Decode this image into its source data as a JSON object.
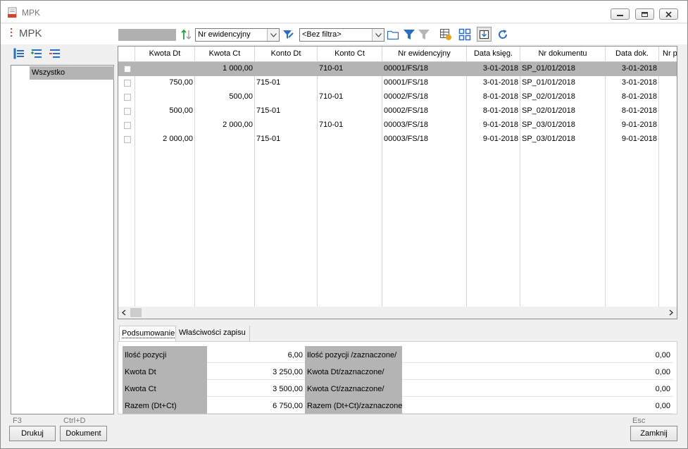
{
  "window": {
    "title": "MPK"
  },
  "header": {
    "title": "MPK"
  },
  "toolbar": {
    "sort_field": "Nr ewidencyjny",
    "filter": "<Bez filtra>"
  },
  "tree": {
    "items": [
      "Wszystko"
    ]
  },
  "grid": {
    "columns": [
      "Kwota Dt",
      "Kwota Ct",
      "Konto Dt",
      "Konto Ct",
      "Nr ewidencyjny",
      "Data księg.",
      "Nr dokumentu",
      "Data dok.",
      "Nr p"
    ],
    "rows": [
      {
        "kwota_dt": "",
        "kwota_ct": "1 000,00",
        "konto_dt": "",
        "konto_ct": "710-01",
        "nr_ewid": "00001/FS/18",
        "data_ksieg": "3-01-2018",
        "nr_dok": "SP_01/01/2018",
        "data_dok": "3-01-2018"
      },
      {
        "kwota_dt": "750,00",
        "kwota_ct": "",
        "konto_dt": "715-01",
        "konto_ct": "",
        "nr_ewid": "00001/FS/18",
        "data_ksieg": "3-01-2018",
        "nr_dok": "SP_01/01/2018",
        "data_dok": "3-01-2018"
      },
      {
        "kwota_dt": "",
        "kwota_ct": "500,00",
        "konto_dt": "",
        "konto_ct": "710-01",
        "nr_ewid": "00002/FS/18",
        "data_ksieg": "8-01-2018",
        "nr_dok": "SP_02/01/2018",
        "data_dok": "8-01-2018"
      },
      {
        "kwota_dt": "500,00",
        "kwota_ct": "",
        "konto_dt": "715-01",
        "konto_ct": "",
        "nr_ewid": "00002/FS/18",
        "data_ksieg": "8-01-2018",
        "nr_dok": "SP_02/01/2018",
        "data_dok": "8-01-2018"
      },
      {
        "kwota_dt": "",
        "kwota_ct": "2 000,00",
        "konto_dt": "",
        "konto_ct": "710-01",
        "nr_ewid": "00003/FS/18",
        "data_ksieg": "9-01-2018",
        "nr_dok": "SP_03/01/2018",
        "data_dok": "9-01-2018"
      },
      {
        "kwota_dt": "2 000,00",
        "kwota_ct": "",
        "konto_dt": "715-01",
        "konto_ct": "",
        "nr_ewid": "00003/FS/18",
        "data_ksieg": "9-01-2018",
        "nr_dok": "SP_03/01/2018",
        "data_dok": "9-01-2018"
      }
    ]
  },
  "tabs": [
    "Podsumowanie",
    "Właściwości zapisu"
  ],
  "summary": {
    "rows": [
      {
        "label": "Ilość pozycji",
        "value": "6,00",
        "label2": "Ilość pozycji /zaznaczone/",
        "value2": "0,00"
      },
      {
        "label": "Kwota Dt",
        "value": "3 250,00",
        "label2": "Kwota Dt/zaznaczone/",
        "value2": "0,00"
      },
      {
        "label": "Kwota Ct",
        "value": "3 500,00",
        "label2": "Kwota Ct/zaznaczone/",
        "value2": "0,00"
      },
      {
        "label": "Razem (Dt+Ct)",
        "value": "6 750,00",
        "label2": "Razem (Dt+Ct)/zaznaczone/",
        "value2": "0,00"
      }
    ]
  },
  "footer": {
    "print_key": "F3",
    "document_key": "Ctrl+D",
    "close_key": "Esc",
    "print_label": "Drukuj",
    "document_label": "Dokument",
    "close_label": "Zamknij"
  },
  "colors": {
    "selection": "#b4b4b4",
    "header_bg": "#ffffff",
    "window_bg": "#f0f0f0"
  }
}
